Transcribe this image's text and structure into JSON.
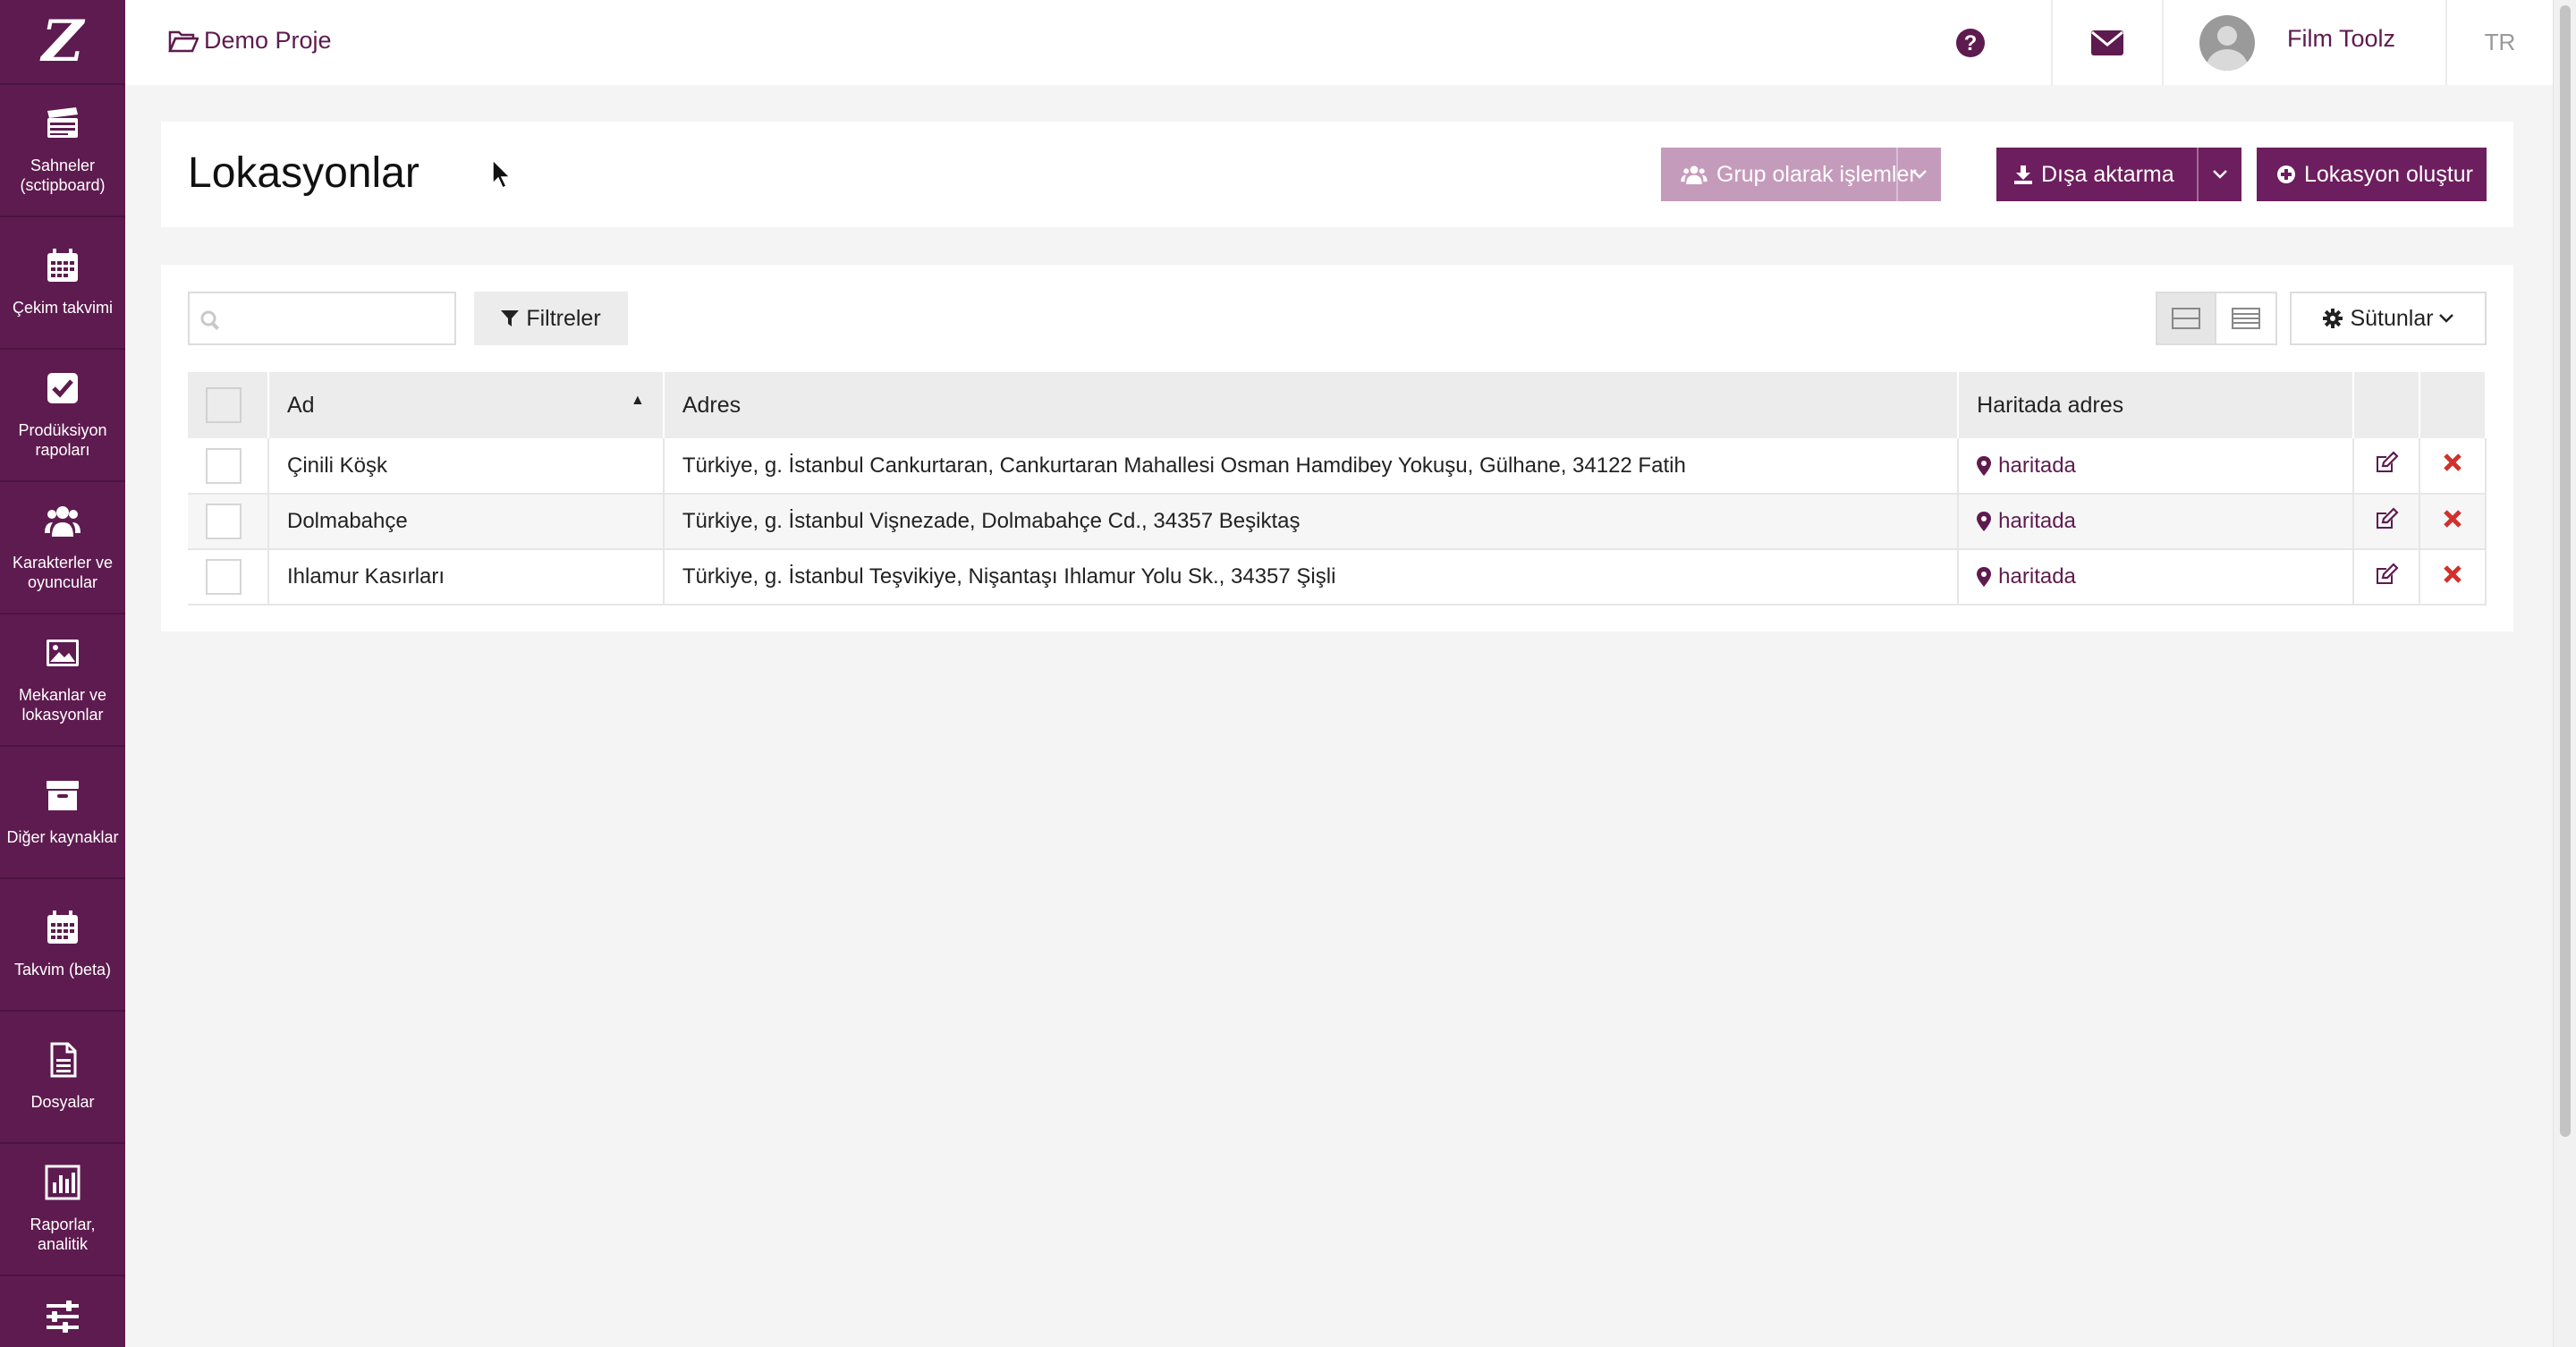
{
  "app": {
    "logo_letter": "Z",
    "project": "Demo Proje",
    "user_name": "Film Toolz",
    "lang": "TR"
  },
  "sidebar": {
    "items": [
      {
        "label": "Sahneler (sctipboard)",
        "icon": "clapperboard-icon"
      },
      {
        "label": "Çekim takvimi",
        "icon": "calendar-icon"
      },
      {
        "label": "Prodüksiyon rapoları",
        "icon": "checkbox-icon"
      },
      {
        "label": "Karakterler ve oyuncular",
        "icon": "users-icon"
      },
      {
        "label": "Mekanlar ve lokasyonlar",
        "icon": "image-icon"
      },
      {
        "label": "Diğer kaynaklar",
        "icon": "archive-icon"
      },
      {
        "label": "Takvim (beta)",
        "icon": "calendar-icon"
      },
      {
        "label": "Dosyalar",
        "icon": "file-icon"
      },
      {
        "label": "Raporlar, analitik",
        "icon": "bar-chart-icon"
      },
      {
        "label": "",
        "icon": "sliders-icon"
      }
    ]
  },
  "page": {
    "title": "Lokasyonlar",
    "group_actions_label": "Grup olarak işlemler",
    "export_label": "Dışa aktarma",
    "create_label": "Lokasyon oluştur"
  },
  "toolbar": {
    "search_placeholder": "",
    "filters_label": "Filtreler",
    "columns_label": "Sütunlar"
  },
  "table": {
    "headers": {
      "name": "Ad",
      "address": "Adres",
      "map": "Haritada adres"
    },
    "rows": [
      {
        "name": "Çinili Köşk",
        "address": "Türkiye, g. İstanbul Cankurtaran, Cankurtaran Mahallesi Osman Hamdibey Yokuşu, Gülhane, 34122 Fatih",
        "map": "haritada"
      },
      {
        "name": "Dolmabahçe",
        "address": "Türkiye, g. İstanbul Vişnezade, Dolmabahçe Cd., 34357 Beşiktaş",
        "map": "haritada"
      },
      {
        "name": "Ihlamur Kasırları",
        "address": "Türkiye, g. İstanbul Teşvikiye, Nişantaşı Ihlamur Yolu Sk., 34357 Şişli",
        "map": "haritada"
      }
    ]
  },
  "colors": {
    "brand": "#5e1b4f",
    "button_dark": "#6d1e5e",
    "button_light": "#c59bbc",
    "delete": "#d0312d"
  }
}
